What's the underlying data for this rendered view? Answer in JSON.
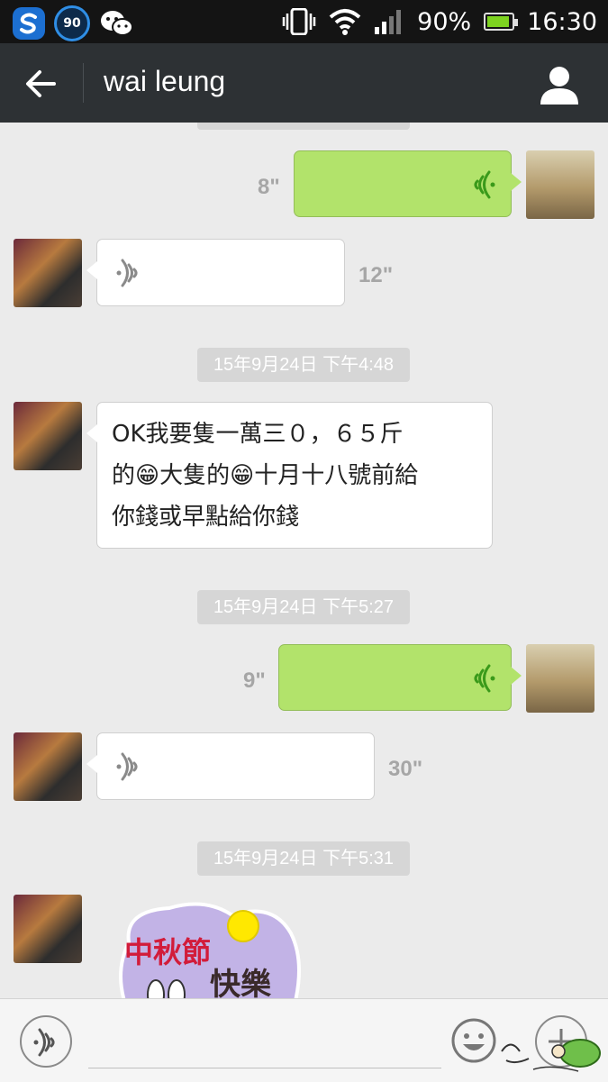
{
  "status_bar": {
    "app_badge": "90",
    "battery_percent": "90%",
    "battery_level": 0.9,
    "time": "16:30"
  },
  "title_bar": {
    "title": "wai leung"
  },
  "messages": {
    "ts_top": "",
    "voice_me_1": {
      "duration": "8\""
    },
    "voice_other_1": {
      "duration": "12\""
    },
    "ts_1": "15年9月24日 下午4:48",
    "text_other_1": "OK我要隻一萬三０，６５斤\n的😁大隻的😁十月十八號前給\n你錢或早點給你錢",
    "ts_2": "15年9月24日 下午5:27",
    "voice_me_2": {
      "duration": "9\""
    },
    "voice_other_2": {
      "duration": "30\""
    },
    "ts_3": "15年9月24日 下午5:31",
    "sticker_text": "中秋節快樂"
  },
  "colors": {
    "sent_bubble": "#b2e36b",
    "received_bubble": "#ffffff",
    "title_bar": "#2d3134",
    "status_bar": "#141414",
    "background": "#ebebeb"
  },
  "icons": [
    "back-arrow-icon",
    "profile-icon",
    "voice-wave-icon",
    "emoji-icon",
    "plus-icon",
    "wechat-icon",
    "wifi-icon",
    "signal-icon",
    "vibrate-icon",
    "battery-icon"
  ]
}
